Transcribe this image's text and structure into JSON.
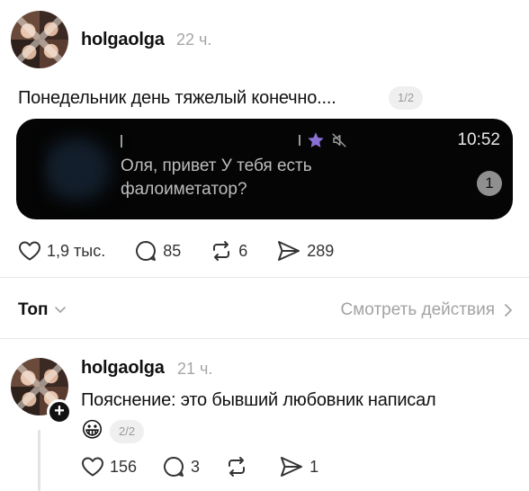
{
  "post": {
    "username": "holgaolga",
    "time": "22 ч.",
    "text": "Понедельник день тяжелый конечно....",
    "page_indicator": "1/2",
    "notification": {
      "time": "10:52",
      "message": "Оля, привет У тебя есть фалоиметатор?",
      "unread_count": "1"
    },
    "likes": "1,9 тыс.",
    "comments": "85",
    "reposts": "6",
    "shares": "289"
  },
  "sort": {
    "label": "Топ",
    "view_activity": "Смотреть действия"
  },
  "reply": {
    "username": "holgaolga",
    "time": "21 ч.",
    "text": "Пояснение: это бывший любовник написал",
    "emoji": "😀",
    "page_indicator": "2/2",
    "likes": "156",
    "comments": "3",
    "reposts": "",
    "shares": "1"
  },
  "colors": {
    "text": "#111111",
    "muted": "#a5a5a5",
    "notification_bg": "#050505",
    "notification_star": "#8b6fd6"
  }
}
